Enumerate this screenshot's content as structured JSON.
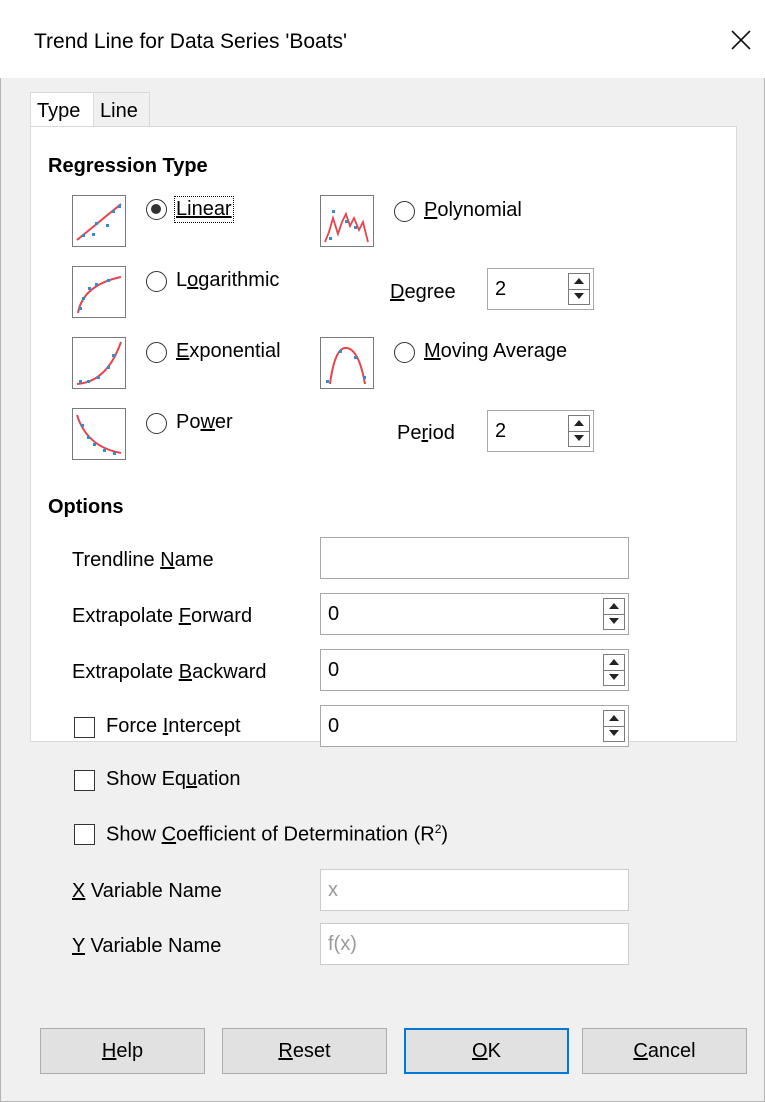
{
  "window": {
    "title": "Trend Line for Data Series 'Boats'"
  },
  "tabs": [
    {
      "label": "Type"
    },
    {
      "label": "Line"
    }
  ],
  "regression": {
    "heading": "Regression Type",
    "linear": {
      "label": "Linear",
      "selected": true
    },
    "logarithmic": {
      "label_a": "L",
      "label_u": "o",
      "label_b": "garithmic",
      "selected": false
    },
    "exponential": {
      "label_u": "E",
      "label_b": "xponential",
      "selected": false
    },
    "power": {
      "label_a": "Po",
      "label_u": "w",
      "label_b": "er",
      "selected": false
    },
    "polynomial": {
      "label_u": "P",
      "label_b": "olynomial",
      "selected": false
    },
    "moving_average": {
      "label_u": "M",
      "label_b": "oving Average",
      "selected": false
    },
    "degree": {
      "label_u": "D",
      "label_b": "egree",
      "value": "2"
    },
    "period": {
      "label_a": "Pe",
      "label_u": "r",
      "label_b": "iod",
      "value": "2"
    }
  },
  "options": {
    "heading": "Options",
    "trendline_name": {
      "label_a": "Trendline ",
      "label_u": "N",
      "label_b": "ame",
      "value": ""
    },
    "extrapolate_forward": {
      "label_a": "Extrapolate ",
      "label_u": "F",
      "label_b": "orward",
      "value": "0"
    },
    "extrapolate_backward": {
      "label_a": "Extrapolate ",
      "label_u": "B",
      "label_b": "ackward",
      "value": "0"
    },
    "force_intercept": {
      "label_a": "Force ",
      "label_u": "I",
      "label_b": "ntercept",
      "checked": false,
      "value": "0"
    },
    "show_equation": {
      "label_a": "Show Eq",
      "label_u": "u",
      "label_b": "ation",
      "checked": false
    },
    "show_r2": {
      "label_a": "Show ",
      "label_u": "C",
      "label_b": "oefficient of Determination (R",
      "sup": "2",
      "label_c": ")",
      "checked": false
    },
    "x_variable": {
      "label_u": "X",
      "label_b": " Variable Name",
      "value": "x"
    },
    "y_variable": {
      "label_u": "Y",
      "label_b": " Variable Name",
      "value": "f(x)"
    }
  },
  "buttons": {
    "help": {
      "label_u": "H",
      "label_b": "elp"
    },
    "reset": {
      "label_u": "R",
      "label_b": "eset"
    },
    "ok": {
      "label_u": "O",
      "label_b": "K"
    },
    "cancel": {
      "label_u": "C",
      "label_b": "ancel"
    }
  },
  "colors": {
    "accent": "#0078d7",
    "curve": "#e8434b",
    "points": "#2c8fd6"
  }
}
